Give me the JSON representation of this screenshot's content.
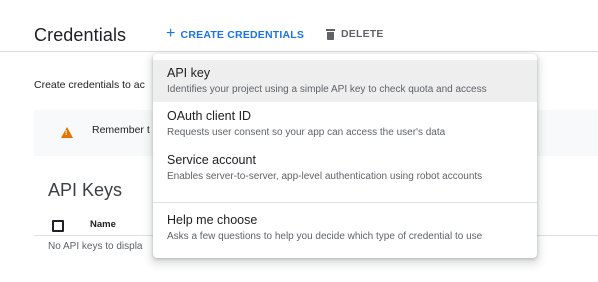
{
  "header": {
    "title": "Credentials",
    "create_label": "CREATE CREDENTIALS",
    "delete_label": "DELETE"
  },
  "page": {
    "intro_text": "Create credentials to ac",
    "notice_text": "Remember t",
    "section_title": "API Keys",
    "table": {
      "columns": [
        "Name"
      ],
      "empty_text": "No API keys to displa"
    }
  },
  "menu": {
    "items": [
      {
        "title": "API key",
        "description": "Identifies your project using a simple API key to check quota and access"
      },
      {
        "title": "OAuth client ID",
        "description": "Requests user consent so your app can access the user's data"
      },
      {
        "title": "Service account",
        "description": "Enables server-to-server, app-level authentication using robot accounts"
      },
      {
        "title": "Help me choose",
        "description": "Asks a few questions to help you decide which type of credential to use"
      }
    ]
  },
  "colors": {
    "accent": "#1a73e8",
    "warning": "#e37400",
    "text_secondary": "#5f6368"
  }
}
